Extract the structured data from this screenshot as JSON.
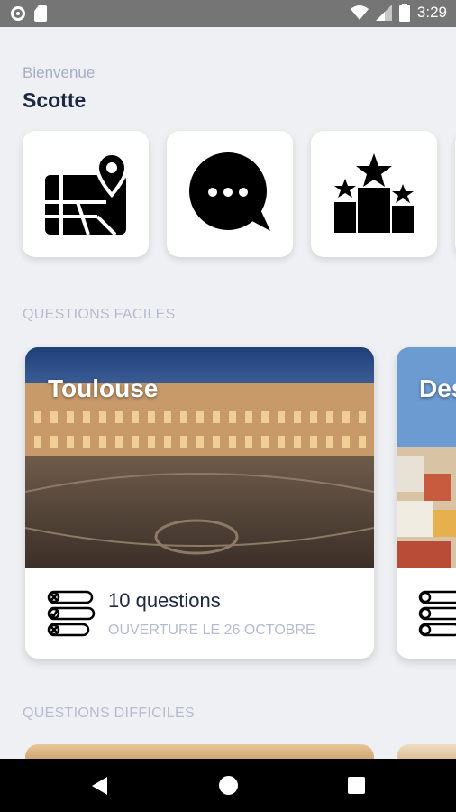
{
  "status_bar": {
    "time": "3:29"
  },
  "header": {
    "welcome": "Bienvenue",
    "username": "Scotte"
  },
  "tiles": [
    {
      "icon": "map-pin-icon"
    },
    {
      "icon": "chat-bubble-icon"
    },
    {
      "icon": "podium-stars-icon"
    }
  ],
  "sections": {
    "easy_title": "QUESTIONS FACILES",
    "hard_title": "QUESTIONS DIFFICILES"
  },
  "cards": [
    {
      "title": "Toulouse",
      "count": "10 questions",
      "subtitle": "OUVERTURE LE 26 OCTOBRE"
    },
    {
      "title": "Des"
    }
  ],
  "colors": {
    "primary_text": "#1c2744",
    "muted_text": "#b6bccf",
    "background": "#eef0f4"
  }
}
